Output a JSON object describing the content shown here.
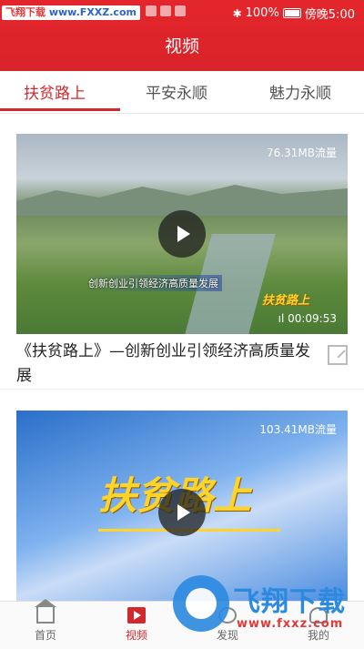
{
  "status_bar": {
    "watermark_prefix": "飞翔下载",
    "watermark_site": "www.FXXZ.com",
    "battery_text": "100%",
    "time_text": "傍晚5:00"
  },
  "header": {
    "title": "视频"
  },
  "tabs": [
    {
      "label": "扶贫路上",
      "active": true
    },
    {
      "label": "平安永顺",
      "active": false
    },
    {
      "label": "魅力永顺",
      "active": false
    }
  ],
  "videos": [
    {
      "size": "76.31MB流量",
      "duration": "00:09:53",
      "title": "《扶贫路上》—创新创业引领经济高质量发展",
      "overlay_caption": "创新创业引领经济高质量发展",
      "logo_text": "扶贫路上"
    },
    {
      "size": "103.41MB流量",
      "duration": "",
      "title": "",
      "logo_text": "扶贫路上"
    }
  ],
  "bottom_nav": [
    {
      "label": "首页",
      "icon": "home-icon",
      "active": false
    },
    {
      "label": "视频",
      "icon": "video-icon",
      "active": true
    },
    {
      "label": "发现",
      "icon": "discover-icon",
      "active": false
    },
    {
      "label": "我的",
      "icon": "profile-icon",
      "active": false
    }
  ],
  "watermark": {
    "name": "飞翔下载",
    "url": "www.fxxz.com"
  },
  "colors": {
    "brand_red": "#d9232a",
    "active_tab": "#d0292e",
    "watermark_blue": "#2b8ae0"
  }
}
